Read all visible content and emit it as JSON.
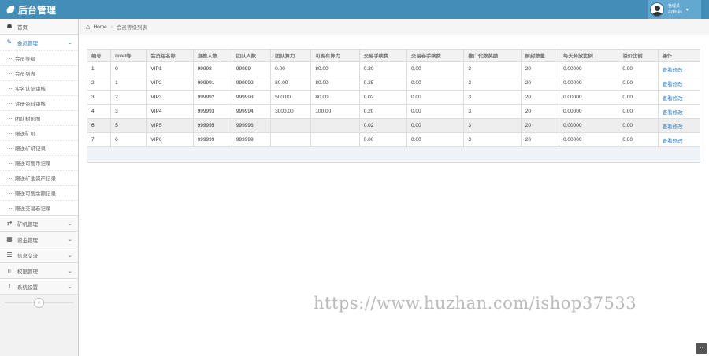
{
  "header": {
    "title": "后台管理",
    "user_role": "管理员",
    "user_name": "admin",
    "caret": "▾"
  },
  "sidebar": {
    "home": {
      "label": "首页",
      "icon": "tachometer-icon",
      "glyph": "☗"
    },
    "member": {
      "label": "会员管理",
      "icon": "edit-icon",
      "glyph": "✎"
    },
    "member_sub": [
      "会员等级",
      "会员列表",
      "实名认证审核",
      "注册资料审核",
      "团队树形图",
      "赠送矿机",
      "赠送矿机记录",
      "赠送可售币记录",
      "赠送矿池资产记录",
      "赠送可售余额记录",
      "赠送交易卷记录"
    ],
    "groups": [
      {
        "label": "矿机管理",
        "icon": "exchange-icon",
        "glyph": "⇄"
      },
      {
        "label": "资金管理",
        "icon": "calendar-icon",
        "glyph": "▦"
      },
      {
        "label": "信息交流",
        "icon": "list-icon",
        "glyph": "☰"
      },
      {
        "label": "权限管理",
        "icon": "file-icon",
        "glyph": "▯"
      },
      {
        "label": "系统设置",
        "icon": "text-width-icon",
        "glyph": "Ⅰ"
      }
    ],
    "chevron": "⌄",
    "collapse_glyph": "«"
  },
  "breadcrumb": {
    "home": "Home",
    "separator": "›",
    "current": "会员等级列表",
    "home_glyph": "⌂"
  },
  "table": {
    "headers": [
      "编号",
      "level等",
      "会员组名称",
      "直推人数",
      "团队人数",
      "团队算力",
      "可拥有算力",
      "交易手续费",
      "交易卷手续费",
      "推广代数奖励",
      "解封数量",
      "每天释放比例",
      "溢价比例",
      "操作"
    ],
    "rows": [
      [
        "1",
        "0",
        "VIP1",
        "99998",
        "99999",
        "0.00",
        "80.00",
        "0.30",
        "0.00",
        "3",
        "20",
        "0.00000",
        "0.00",
        "查看修改"
      ],
      [
        "2",
        "1",
        "VIP2",
        "999991",
        "999992",
        "80.00",
        "80.00",
        "0.25",
        "0.00",
        "3",
        "20",
        "0.00000",
        "0.00",
        "查看修改"
      ],
      [
        "3",
        "2",
        "VIP3",
        "999992",
        "999993",
        "500.00",
        "80.00",
        "0.02",
        "0.00",
        "3",
        "20",
        "0.00000",
        "0.00",
        "查看修改"
      ],
      [
        "4",
        "3",
        "VIP4",
        "999993",
        "999994",
        "3000.00",
        "100.00",
        "0.20",
        "0.00",
        "3",
        "20",
        "0.00000",
        "0.00",
        "查看修改"
      ],
      [
        "6",
        "5",
        "VIP5",
        "999995",
        "999996",
        "",
        "",
        "0.02",
        "0.00",
        "3",
        "20",
        "0.00000",
        "0.00",
        "查看修改"
      ],
      [
        "7",
        "6",
        "VIP6",
        "999999",
        "999999",
        "",
        "",
        "0.00",
        "0.00",
        "3",
        "20",
        "0.00000",
        "0.00",
        "查看修改"
      ]
    ]
  },
  "watermark": "https://www.huzhan.com/ishop37533",
  "to_top_glyph": "⌃"
}
